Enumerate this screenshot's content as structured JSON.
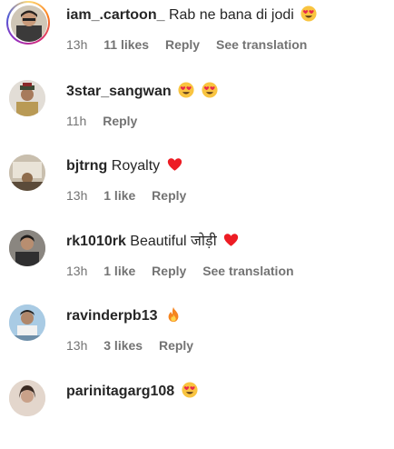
{
  "comments": [
    {
      "username": "iam_.cartoon_",
      "text": "Rab ne bana di jodi",
      "emojis": [
        "heart-eyes-emoji"
      ],
      "time": "13h",
      "likes": "11 likes",
      "reply": "Reply",
      "translate": "See translation",
      "has_story_ring": true
    },
    {
      "username": "3star_sangwan",
      "text": "",
      "emojis": [
        "heart-eyes-emoji",
        "heart-eyes-emoji"
      ],
      "time": "11h",
      "likes": "",
      "reply": "Reply",
      "translate": ""
    },
    {
      "username": "bjtrng",
      "text": "Royalty",
      "emojis": [
        "red-heart-emoji"
      ],
      "time": "13h",
      "likes": "1 like",
      "reply": "Reply",
      "translate": ""
    },
    {
      "username": "rk1010rk",
      "text": "Beautiful जोड़ी",
      "emojis": [
        "red-heart-emoji"
      ],
      "time": "13h",
      "likes": "1 like",
      "reply": "Reply",
      "translate": "See translation"
    },
    {
      "username": "ravinderpb13",
      "text": "",
      "emojis": [
        "fire-emoji"
      ],
      "time": "13h",
      "likes": "3 likes",
      "reply": "Reply",
      "translate": ""
    },
    {
      "username": "parinitagarg108",
      "text": "",
      "emojis": [
        "heart-eyes-emoji"
      ],
      "time": "",
      "likes": "",
      "reply": "",
      "translate": ""
    }
  ],
  "colors": {
    "text": "#262626",
    "meta": "#737373",
    "heart": "#ed1c24",
    "emoji_face": "#f7c02b"
  }
}
